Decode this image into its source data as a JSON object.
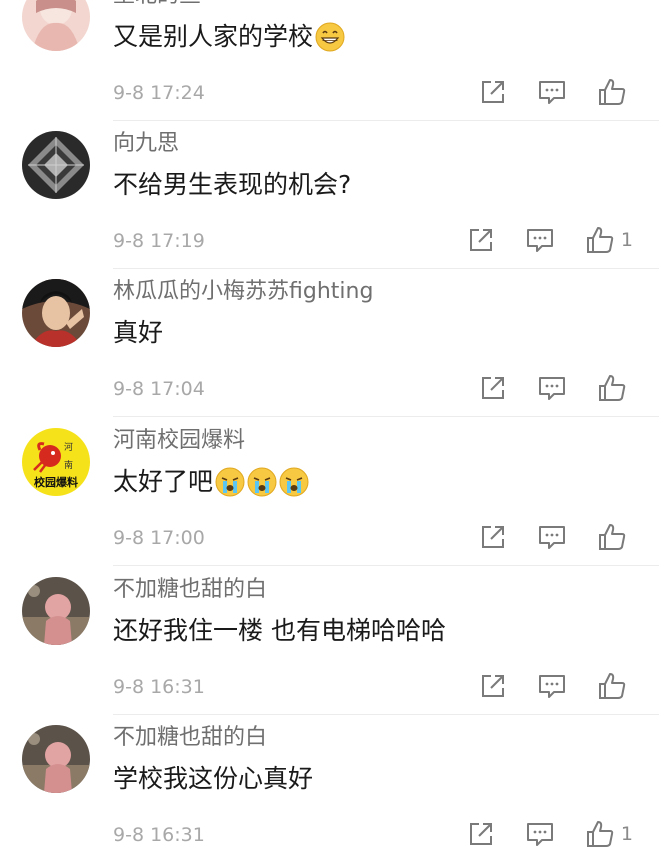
{
  "comments": [
    {
      "username": "墨北的鱼",
      "text": "又是别人家的学校",
      "emoji": [
        "grin-emoji"
      ],
      "time": "9-8 17:24",
      "likes": ""
    },
    {
      "username": "向九思",
      "text": "不给男生表现的机会?",
      "emoji": [],
      "time": "9-8 17:19",
      "likes": "1"
    },
    {
      "username": "林瓜瓜的小梅苏苏fighting",
      "text": "真好",
      "emoji": [],
      "time": "9-8 17:04",
      "likes": ""
    },
    {
      "username": "河南校园爆料",
      "text": "太好了吧",
      "emoji": [
        "crying-emoji",
        "crying-emoji",
        "crying-emoji"
      ],
      "time": "9-8 17:00",
      "likes": ""
    },
    {
      "username": "不加糖也甜的白",
      "text": "还好我住一楼 也有电梯哈哈哈",
      "emoji": [],
      "time": "9-8 16:31",
      "likes": ""
    },
    {
      "username": "不加糖也甜的白",
      "text": "学校我这份心真好",
      "emoji": [],
      "time": "9-8 16:31",
      "likes": "1"
    }
  ],
  "avatar_badge": {
    "top_left": "河",
    "top_right": "南",
    "bottom": "校园爆料"
  },
  "colors": {
    "text_primary": "#1a1a1a",
    "text_username": "#6f6f6f",
    "text_time": "#a8a8a8",
    "icon_stroke": "#7a7a7a",
    "divider": "#ececec",
    "emoji_yellow": "#f7c842"
  }
}
